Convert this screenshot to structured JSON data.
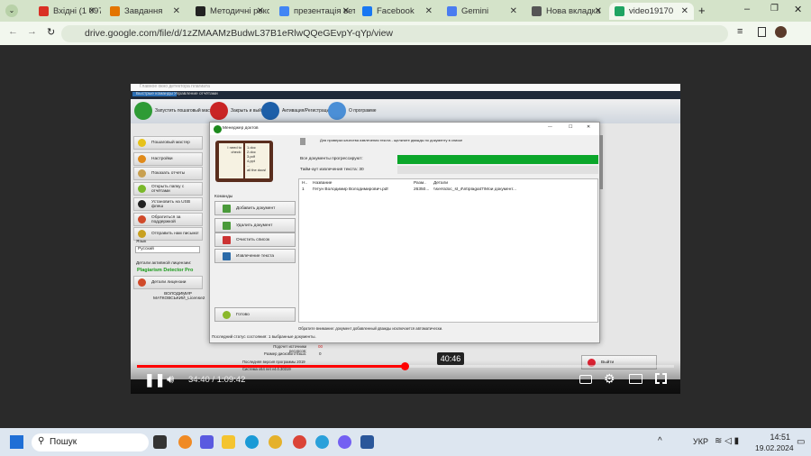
{
  "browser": {
    "tabs": [
      {
        "label": "Вхідні (1 097) - і",
        "color": "#d93025"
      },
      {
        "label": "Завдання",
        "color": "#e37400"
      },
      {
        "label": "Методичні реко",
        "color": "#222"
      },
      {
        "label": "презентація вет",
        "color": "#4285f4"
      },
      {
        "label": "Facebook",
        "color": "#1877f2"
      },
      {
        "label": "Gemini",
        "color": "#4a7cf0"
      },
      {
        "label": "Нова вкладка",
        "color": "#555"
      },
      {
        "label": "video19170",
        "color": "#1fa463"
      }
    ],
    "url": "drive.google.com/file/d/1zZMAAMzBudwL37B1eRlwQQeGEvpY-qYp/view"
  },
  "app": {
    "title": "Главное окно детектора плагиата",
    "menu": [
      "Быстрые команды",
      "Управление отчётами"
    ],
    "toolbar": [
      "Запустить пошаговый мастер",
      "Закрыть и выйти",
      "Активация/Регистрация",
      "О программе"
    ],
    "sidebar": [
      "Пошаговый мастер",
      "Настройки",
      "Показать отчеты",
      "Открыть папку с отчётами",
      "Установить на USB флеш",
      "Обратиться за поддержкой",
      "Отправить нам письмо!"
    ],
    "language_label": "Язык",
    "language_value": "Русский",
    "license_label": "Детали активной лицензии:",
    "product": "Plagiarism Detector Pro",
    "license_button": "Детали лицензии",
    "licensee": "ВОЛОДИМИР МАТКОВСЬКИЙ_License2",
    "sources_label": "Подсчет источники ресурсов:",
    "sources_value": "00",
    "cache_label": "Размер дискового кэша:",
    "cache_value": "0",
    "version_label": "Последняя версия программы 2019",
    "system_label": "Система x64 net v4.0.30319",
    "exit_button": "Выйти"
  },
  "dialog": {
    "title": "Менеджер доктов",
    "hint": "Для проверки качества извлечения текста - щелкните дважды по документу в списке",
    "progress_label": "Все документы прогрессируют:",
    "progress": 1.0,
    "timeout_label": "Тайм-аут извлечения текста: 30",
    "book_left": "I need to check:",
    "book_right": [
      "1.doc",
      "2.doc",
      "3.pdf",
      "4.ppt",
      "...",
      "all the docs!"
    ],
    "commands_label": "Команды",
    "commands": [
      "Добавить документ",
      "Удалить документ",
      "Очистить список",
      "Извлечение текста"
    ],
    "ready_button": "Готово",
    "columns": [
      "Н..",
      "Название",
      "Разм..",
      "Детали"
    ],
    "rows": [
      [
        "1",
        "Гетун Володимир Володимирович.pdf",
        "26350...",
        "\\\\sers\\doc_st_if\\nt\\plagiat7\\Мои документ..."
      ]
    ],
    "note": "Обратите внимание: документ добавленный дважды исключается автоматически.",
    "status": "Последний статус состояния: 1 выбранные документы."
  },
  "player": {
    "time": "34:40 / 1:09:42",
    "tooltip": "40:46",
    "progress": 0.4976
  },
  "taskbar": {
    "search": "Пошук",
    "lang": "УКР",
    "time": "14:51",
    "date": "19.02.2024"
  },
  "colors": {
    "accent": "#ff0000",
    "progress_green": "#0aa62a"
  }
}
